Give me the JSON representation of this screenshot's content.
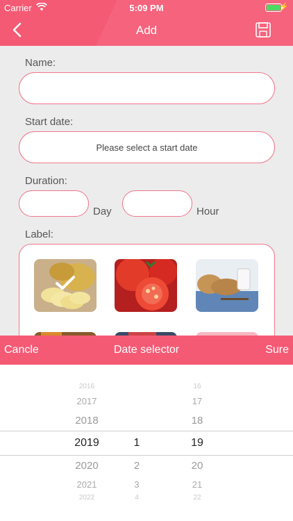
{
  "status": {
    "carrier": "Carrier",
    "time": "5:09 PM"
  },
  "nav": {
    "title": "Add"
  },
  "form": {
    "name_label": "Name:",
    "name_value": "",
    "start_label": "Start date:",
    "start_placeholder": "Please select a start date",
    "duration_label": "Duration:",
    "day_unit": "Day",
    "hour_unit": "Hour",
    "label_label": "Label:"
  },
  "picker": {
    "cancel": "Cancle",
    "title": "Date selector",
    "confirm": "Sure",
    "years": [
      "2016",
      "2017",
      "2018",
      "2019",
      "2020",
      "2021",
      "2022"
    ],
    "months": [
      "1",
      "2",
      "3",
      "4"
    ],
    "days": [
      "16",
      "17",
      "18",
      "19",
      "20",
      "21",
      "22"
    ],
    "selected": {
      "year": "2019",
      "month": "1",
      "day": "19"
    }
  },
  "colors": {
    "accent": "#f55a75",
    "border": "#f0758b"
  }
}
